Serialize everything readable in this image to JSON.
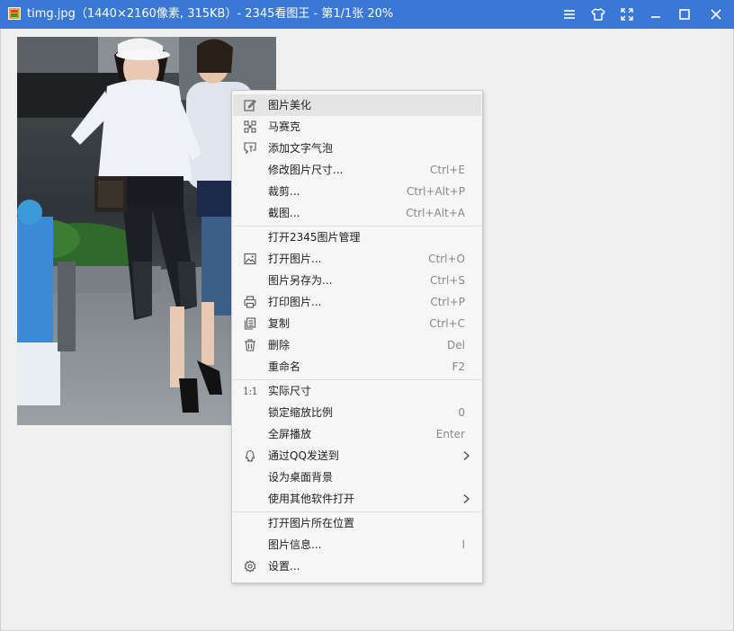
{
  "window": {
    "title": "timg.jpg（1440×2160像素, 315KB）- 2345看图王 - 第1/1张 20%",
    "accent_color": "#3a78d6"
  },
  "titlebar_icons": [
    "menu-icon",
    "skin-icon",
    "fullscreen-icon",
    "minimize-icon",
    "maximize-icon",
    "close-icon"
  ],
  "context_menu": {
    "items": [
      {
        "label": "图片美化",
        "shortcut": "",
        "icon": "edit-icon"
      },
      {
        "label": "马赛克",
        "shortcut": "",
        "icon": "mosaic-icon"
      },
      {
        "label": "添加文字气泡",
        "shortcut": "",
        "icon": "text-bubble-icon"
      },
      {
        "label": "修改图片尺寸...",
        "shortcut": "Ctrl+E",
        "icon": ""
      },
      {
        "label": "裁剪...",
        "shortcut": "Ctrl+Alt+P",
        "icon": ""
      },
      {
        "label": "截图...",
        "shortcut": "Ctrl+Alt+A",
        "icon": ""
      },
      {
        "label": "打开2345图片管理",
        "shortcut": "",
        "icon": ""
      },
      {
        "label": "打开图片...",
        "shortcut": "Ctrl+O",
        "icon": "image-icon"
      },
      {
        "label": "图片另存为...",
        "shortcut": "Ctrl+S",
        "icon": ""
      },
      {
        "label": "打印图片...",
        "shortcut": "Ctrl+P",
        "icon": "print-icon"
      },
      {
        "label": "复制",
        "shortcut": "Ctrl+C",
        "icon": "copy-icon"
      },
      {
        "label": "删除",
        "shortcut": "Del",
        "icon": "trash-icon"
      },
      {
        "label": "重命名",
        "shortcut": "F2",
        "icon": ""
      },
      {
        "label": "实际尺寸",
        "shortcut": "",
        "icon": "actual-size-icon",
        "icon_text": "1:1"
      },
      {
        "label": "锁定缩放比例",
        "shortcut": "0",
        "icon": ""
      },
      {
        "label": "全屏播放",
        "shortcut": "Enter",
        "icon": ""
      },
      {
        "label": "通过QQ发送到",
        "shortcut": "",
        "icon": "qq-icon",
        "submenu": true
      },
      {
        "label": "设为桌面背景",
        "shortcut": "",
        "icon": ""
      },
      {
        "label": "使用其他软件打开",
        "shortcut": "",
        "icon": "",
        "submenu": true
      },
      {
        "label": "打开图片所在位置",
        "shortcut": "",
        "icon": ""
      },
      {
        "label": "图片信息...",
        "shortcut": "I",
        "icon": ""
      },
      {
        "label": "设置...",
        "shortcut": "",
        "icon": "gear-icon"
      }
    ]
  }
}
